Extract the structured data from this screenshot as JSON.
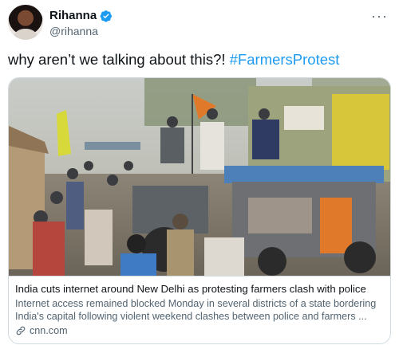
{
  "author": {
    "display_name": "Rihanna",
    "handle": "@rihanna"
  },
  "tweet": {
    "text": "why aren’t we talking about this?! ",
    "hashtag": "#FarmersProtest"
  },
  "card": {
    "title": "India cuts internet around New Delhi as protesting farmers clash with police",
    "description": "Internet access remained blocked Monday in several districts of a state bordering India's capital following violent weekend clashes between police and farmers ...",
    "domain": "cnn.com"
  },
  "icons": [
    "verified-badge-icon",
    "more-options-icon",
    "link-icon"
  ],
  "colors": {
    "link": "#1d9bf0",
    "text": "#0f1419",
    "secondary": "#536471",
    "border": "#cfd9de"
  }
}
